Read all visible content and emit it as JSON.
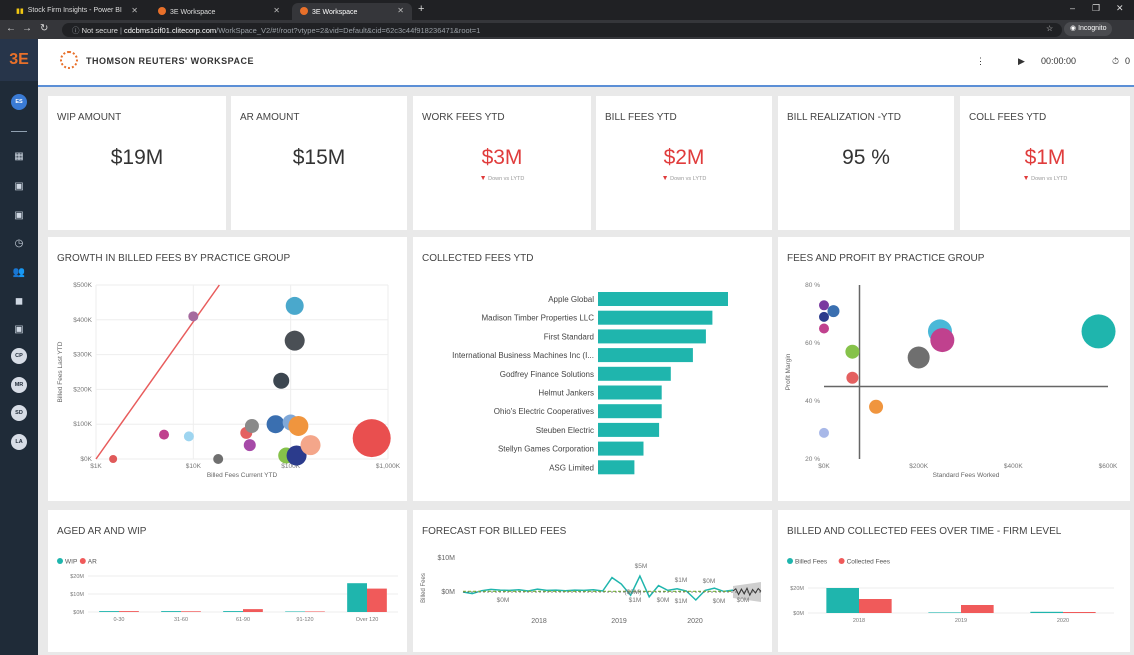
{
  "browser": {
    "tabs": [
      {
        "label": "Stock Firm Insights - Power BI",
        "icon": "power-bi-icon"
      },
      {
        "label": "3E Workspace",
        "icon": "3e-favicon"
      },
      {
        "label": "3E Workspace",
        "icon": "3e-favicon"
      }
    ],
    "new_tab": "+",
    "url_not_secure": "Not secure",
    "url_host": "cdcbms1cif01.clitecorp.com",
    "url_path": "/WorkSpace_V2/#!/root?vtype=2&vid=Default&cid=62c3c44f918236471&root=1",
    "incognito_label": "Incognito"
  },
  "app": {
    "logo": "3E",
    "brand": "THOMSON REUTERS' WORKSPACE",
    "timer": "00:00:00",
    "stopwatch": "0",
    "user_initials": "ES",
    "nav_badges": [
      "CP",
      "MR",
      "SD",
      "LA"
    ]
  },
  "kpis": [
    {
      "title": "WIP AMOUNT",
      "value": "$19M"
    },
    {
      "title": "AR AMOUNT",
      "value": "$15M"
    },
    {
      "title": "WORK FEES YTD",
      "value": "$3M",
      "sub": "Down vs LYTD"
    },
    {
      "title": "BILL FEES YTD",
      "value": "$2M",
      "sub": "Down vs LYTD"
    },
    {
      "title": "BILL REALIZATION -YTD",
      "value": "95 %"
    },
    {
      "title": "COLL FEES YTD",
      "value": "$1M",
      "sub": "Down vs LYTD"
    }
  ],
  "panels": {
    "growth": "GROWTH IN BILLED FEES BY PRACTICE GROUP",
    "collected": "COLLECTED FEES YTD",
    "profit": "FEES AND PROFIT BY PRACTICE GROUP",
    "aged": "AGED AR AND WIP",
    "forecast": "FORECAST FOR BILLED FEES",
    "overtime": "BILLED AND COLLECTED FEES OVER TIME - FIRM LEVEL"
  },
  "chart_data": [
    {
      "type": "scatter",
      "xlabel": "Billed Fees Current YTD",
      "ylabel": "Billed Fees Last YTD",
      "x_ticks": [
        "$1K",
        "$10K",
        "$100K",
        "$1,000K"
      ],
      "y_ticks": [
        "$0K",
        "$100K",
        "$200K",
        "$300K",
        "$400K",
        "$500K"
      ],
      "ylim": [
        0,
        500
      ],
      "points": [
        {
          "x": 1.5,
          "y": 0,
          "r": 4,
          "color": "#e05a5a"
        },
        {
          "x": 5,
          "y": 70,
          "r": 5,
          "color": "#c0418e"
        },
        {
          "x": 10,
          "y": 410,
          "r": 5,
          "color": "#a56a9e"
        },
        {
          "x": 9,
          "y": 65,
          "r": 5,
          "color": "#9ed5f0"
        },
        {
          "x": 18,
          "y": 0,
          "r": 5,
          "color": "#6f6f6f"
        },
        {
          "x": 35,
          "y": 75,
          "r": 6,
          "color": "#e46060"
        },
        {
          "x": 38,
          "y": 40,
          "r": 6,
          "color": "#a64aa8"
        },
        {
          "x": 40,
          "y": 95,
          "r": 7,
          "color": "#8a8a8a"
        },
        {
          "x": 70,
          "y": 100,
          "r": 9,
          "color": "#3a6fb0"
        },
        {
          "x": 80,
          "y": 225,
          "r": 8,
          "color": "#3c4650"
        },
        {
          "x": 100,
          "y": 105,
          "r": 8,
          "color": "#7fa8d8"
        },
        {
          "x": 110,
          "y": 340,
          "r": 10,
          "color": "#4a4f55"
        },
        {
          "x": 110,
          "y": 440,
          "r": 9,
          "color": "#4aa8cc"
        },
        {
          "x": 120,
          "y": 95,
          "r": 10,
          "color": "#f0953e"
        },
        {
          "x": 90,
          "y": 10,
          "r": 8,
          "color": "#86c24a"
        },
        {
          "x": 115,
          "y": 10,
          "r": 10,
          "color": "#2b3b8c"
        },
        {
          "x": 160,
          "y": 40,
          "r": 10,
          "color": "#f4a68a"
        },
        {
          "x": 680,
          "y": 60,
          "r": 19,
          "color": "#e94f4f"
        }
      ]
    },
    {
      "type": "bar",
      "orientation": "horizontal",
      "categories": [
        "Apple Global",
        "Madison Timber Properties LLC",
        "First Standard",
        "International Business Machines Inc (I...",
        "Godfrey Finance Solutions",
        "Helmut Jankers",
        "Ohio's Electric Cooperatives",
        "Steuben Electric",
        "Stellyn Games Corporation",
        "ASG Limited"
      ],
      "values": [
        100,
        88,
        83,
        73,
        56,
        49,
        49,
        47,
        35,
        28
      ],
      "color": "#1fb5ad"
    },
    {
      "type": "scatter",
      "xlabel": "Standard Fees Worked",
      "ylabel": "Profit Margin",
      "x_ticks": [
        "$0K",
        "$200K",
        "$400K",
        "$600K"
      ],
      "y_ticks": [
        "20 %",
        "40 %",
        "60 %",
        "80 %"
      ],
      "xlim": [
        0,
        600
      ],
      "ylim": [
        20,
        80
      ],
      "points": [
        {
          "x": 0,
          "y": 73,
          "r": 5,
          "color": "#7a3aa0"
        },
        {
          "x": 20,
          "y": 71,
          "r": 6,
          "color": "#3a6fb0"
        },
        {
          "x": 0,
          "y": 69,
          "r": 5,
          "color": "#2b3b8c"
        },
        {
          "x": 0,
          "y": 65,
          "r": 5,
          "color": "#c0418e"
        },
        {
          "x": 60,
          "y": 57,
          "r": 7,
          "color": "#86c24a"
        },
        {
          "x": 60,
          "y": 48,
          "r": 6,
          "color": "#e46060"
        },
        {
          "x": 110,
          "y": 38,
          "r": 7,
          "color": "#f0953e"
        },
        {
          "x": 0,
          "y": 29,
          "r": 5,
          "color": "#a8b8e8"
        },
        {
          "x": 200,
          "y": 55,
          "r": 11,
          "color": "#6f6f6f"
        },
        {
          "x": 245,
          "y": 64,
          "r": 12,
          "color": "#4ab8d8"
        },
        {
          "x": 250,
          "y": 61,
          "r": 12,
          "color": "#c0418e"
        },
        {
          "x": 580,
          "y": 64,
          "r": 17,
          "color": "#1fb5ad"
        }
      ],
      "reference_lines": {
        "x": 75,
        "y": 45
      }
    },
    {
      "type": "bar",
      "legend": [
        "WIP",
        "AR"
      ],
      "colors": [
        "#1fb5ad",
        "#f05a5a"
      ],
      "categories": [
        "0-30",
        "31-60",
        "61-90",
        "91-120",
        "Over 120"
      ],
      "y_ticks": [
        "$0M",
        "$10M",
        "$20M"
      ],
      "ylim": [
        0,
        20
      ],
      "series": [
        {
          "name": "WIP",
          "values": [
            0.5,
            0.5,
            0.5,
            0.3,
            16
          ]
        },
        {
          "name": "AR",
          "values": [
            0.5,
            0.4,
            1.6,
            0.3,
            13
          ]
        }
      ]
    },
    {
      "type": "line",
      "ylabel": "Billed Fees",
      "y_ticks": [
        "$10M",
        "$0M"
      ],
      "x_ticks": [
        "2018",
        "2019",
        "2020"
      ],
      "annotations": [
        "$5M",
        "$1M",
        "$1M",
        "$1M",
        "$0M",
        "$0M",
        "($0M)",
        "$0M",
        "$0M",
        "$0M"
      ],
      "series": [
        {
          "values": [
            0,
            -0.5,
            0.4,
            0.8,
            0.6,
            0.5,
            0.7,
            0.3,
            0.9,
            0.5,
            0.6,
            0.4,
            0.6,
            0.5,
            0.7,
            0.3,
            4.5,
            2.5,
            -1,
            5,
            -1.5,
            2,
            0.5,
            1,
            0.3,
            -2.5,
            0.5,
            1.2,
            0.2,
            0.6
          ],
          "color": "#1fb5ad"
        },
        {
          "values": [
            0.2,
            0.2,
            0.2,
            0.2,
            0.2,
            0.2,
            0.2,
            0.2,
            0.2,
            0.2,
            0.2,
            0.2,
            0.2,
            0.2,
            0.2,
            0.2,
            0.2,
            0.2,
            0.2,
            0.2,
            0.2,
            0.2,
            0.2,
            0.2,
            0.2,
            0.2,
            0.2,
            0.2,
            0.2,
            0.2
          ],
          "color": "#86c24a"
        }
      ],
      "forecast": [
        0.3,
        1,
        -0.8,
        0.9,
        -0.6,
        1.2,
        -1,
        0.8,
        -0.3,
        1.1,
        0.2
      ]
    },
    {
      "type": "bar",
      "legend": [
        "Billed Fees",
        "Collected Fees"
      ],
      "colors": [
        "#1fb5ad",
        "#f05a5a"
      ],
      "categories": [
        "2018",
        "2019",
        "2020"
      ],
      "y_ticks": [
        "$0M",
        "$20M"
      ],
      "ylim": [
        0,
        25
      ],
      "series": [
        {
          "name": "Billed Fees",
          "values": [
            25,
            0.6,
            1.2
          ]
        },
        {
          "name": "Collected Fees",
          "values": [
            14,
            8,
            1
          ]
        }
      ]
    }
  ]
}
